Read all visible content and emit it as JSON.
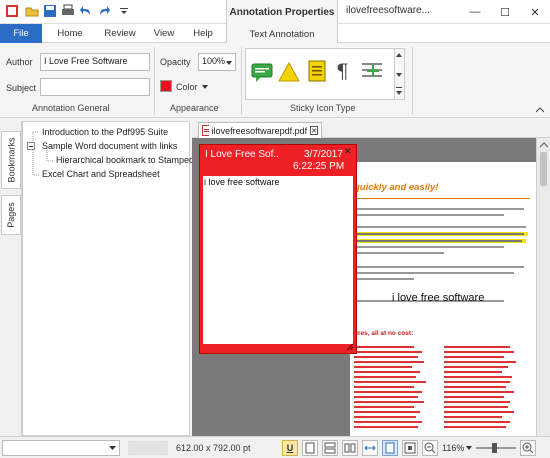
{
  "titlebar": {
    "context_tab": "Annotation Properties",
    "app_title": "ilovefreesoftware...",
    "minimize": "—",
    "maximize": "☐",
    "close": "✕"
  },
  "tabs": [
    "File",
    "Home",
    "Review",
    "View",
    "Help",
    "Text Annotation"
  ],
  "ribbon": {
    "author_label": "Author",
    "author_value": "I Love Free Software",
    "subject_label": "Subject",
    "subject_value": "",
    "group_general": "Annotation General",
    "opacity_label": "Opacity",
    "opacity_value": "100%",
    "color_label": "Color",
    "color_value": "#e8121a",
    "group_appearance": "Appearance",
    "group_icon": "Sticky Icon Type"
  },
  "side_tabs": [
    "Bookmarks",
    "Pages"
  ],
  "bookmarks": [
    "Introduction to the Pdf995 Suite",
    "Sample Word document with links",
    "Hierarchical bookmark to Stamped",
    "Excel Chart and Spreadsheet"
  ],
  "doc_tab": "ilovefreesoftwarepdf.pdf",
  "note": {
    "author": "I Love Free Sof..",
    "date": "3/7/2017",
    "time": "6:22:25 PM",
    "text": "i love free software",
    "close": "✕"
  },
  "page": {
    "heading": "quickly and easily!",
    "stamp": "i love free software",
    "subheading": "ures, all at no cost:"
  },
  "statusbar": {
    "page_size": "612.00 x 792.00 pt",
    "zoom": "116%"
  },
  "colors": {
    "accent": "#2b6cc4",
    "note_red": "#ef1f26",
    "heading_orange": "#e07b00"
  }
}
